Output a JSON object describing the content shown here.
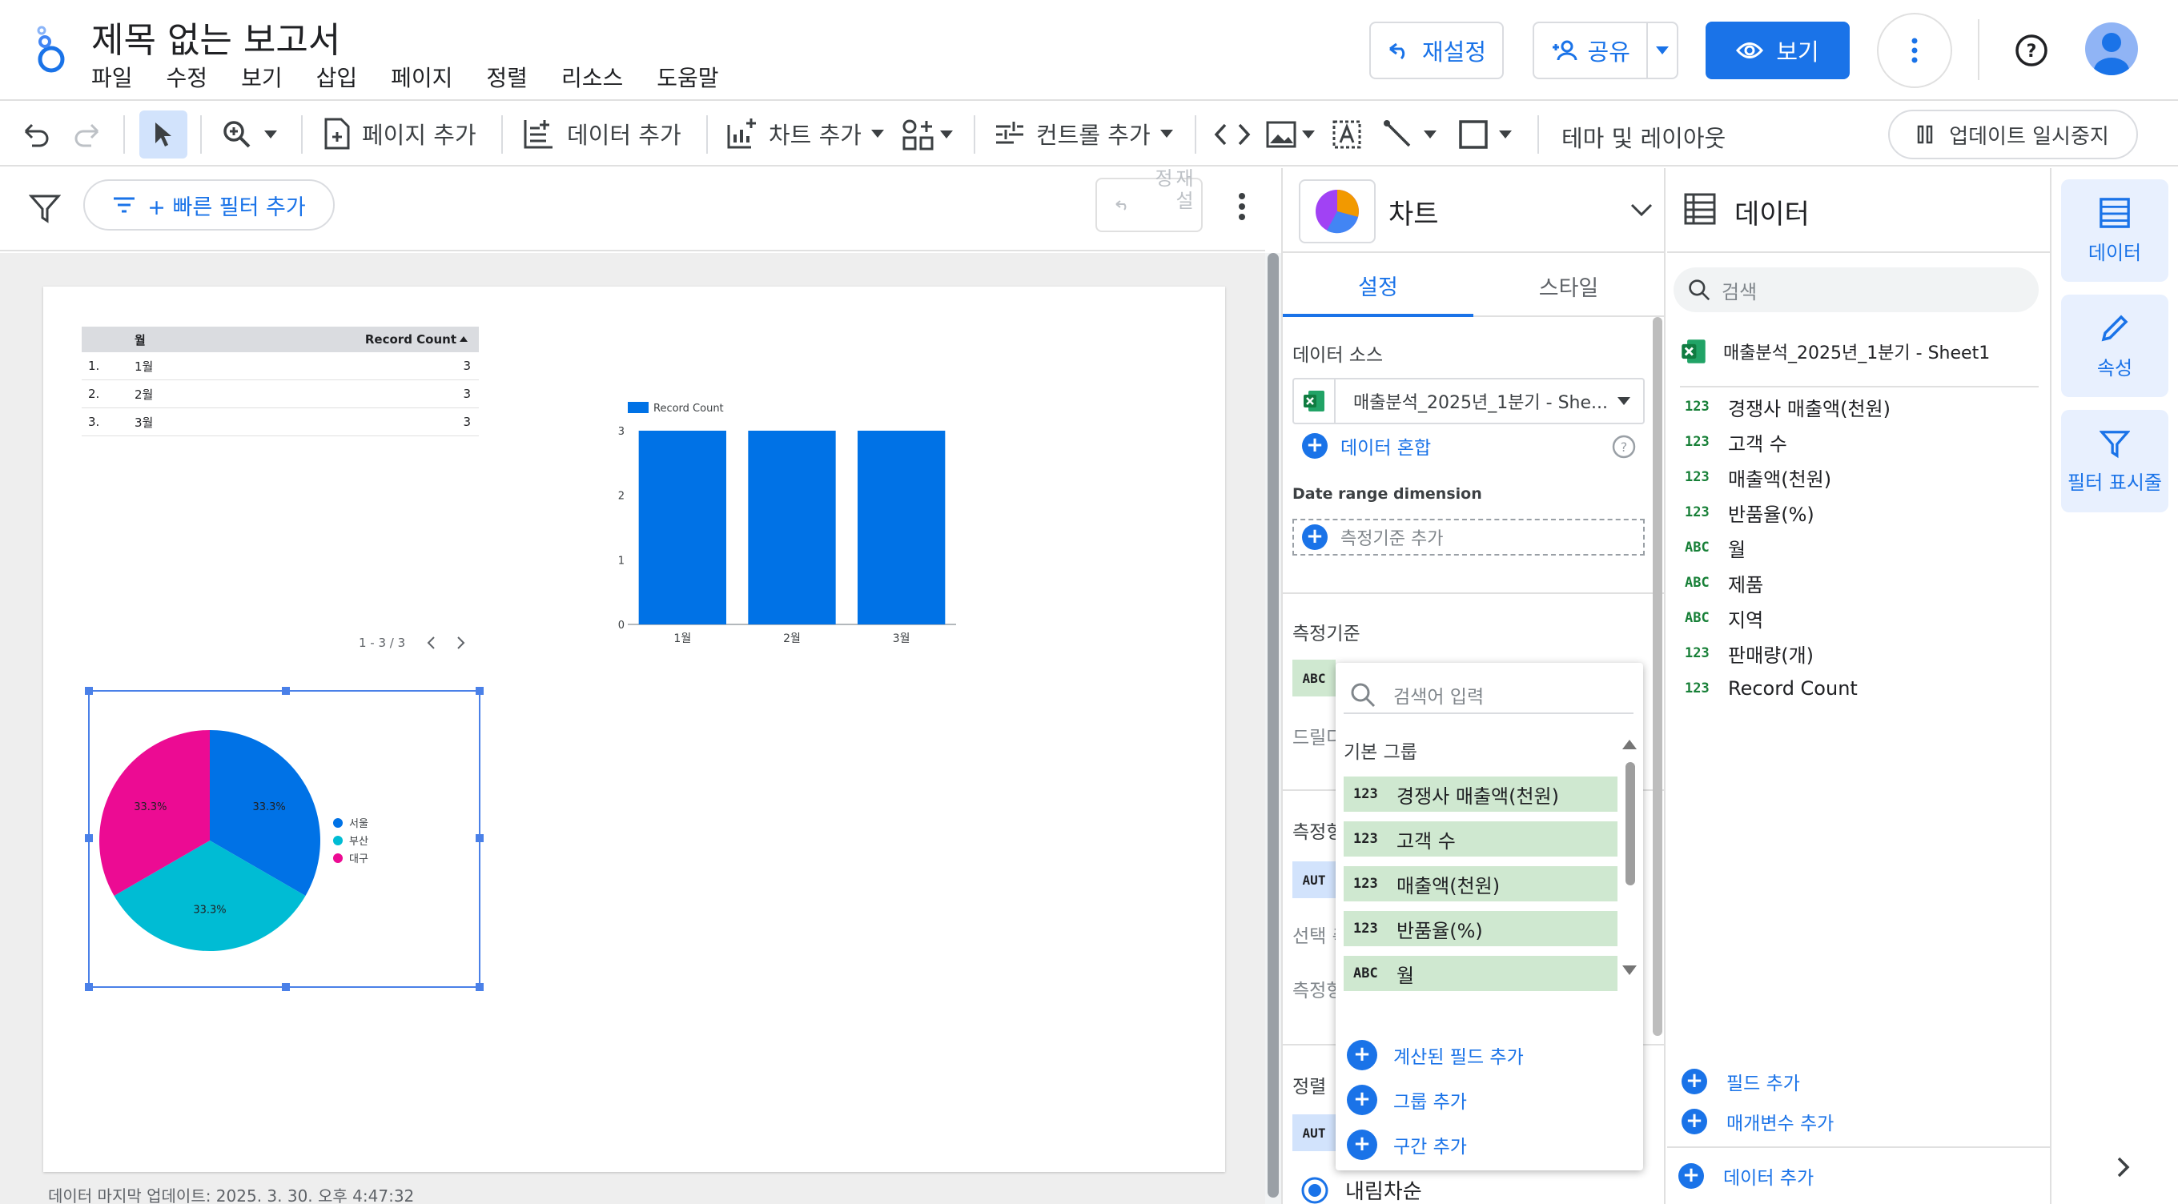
{
  "app": {
    "title": "제목 없는 보고서",
    "menu": [
      "파일",
      "수정",
      "보기",
      "삽입",
      "페이지",
      "정렬",
      "리소스",
      "도움말"
    ],
    "reset_label": "재설정",
    "share_label": "공유",
    "view_label": "보기"
  },
  "toolbar": {
    "add_page": "페이지 추가",
    "add_data": "데이터 추가",
    "add_chart": "차트 추가",
    "add_control": "컨트롤 추가",
    "theme_layout": "테마 및 레이아웃",
    "pause_update": "업데이트 일시중지"
  },
  "filterbar": {
    "quick_filter": "+ 빠른 필터 추가",
    "reset": "재설정"
  },
  "report": {
    "table": {
      "headers": [
        "월",
        "Record Count"
      ],
      "rows": [
        {
          "idx": "1.",
          "month": "1월",
          "count": "3"
        },
        {
          "idx": "2.",
          "month": "2월",
          "count": "3"
        },
        {
          "idx": "3.",
          "month": "3월",
          "count": "3"
        }
      ],
      "pagination": "1 - 3 / 3"
    },
    "footer": "데이터 마지막 업데이트: 2025. 3. 30. 오후 4:47:32"
  },
  "chart_data": [
    {
      "type": "table",
      "columns": [
        "월",
        "Record Count"
      ],
      "rows": [
        [
          "1월",
          3
        ],
        [
          "2월",
          3
        ],
        [
          "3월",
          3
        ]
      ]
    },
    {
      "type": "bar",
      "categories": [
        "1월",
        "2월",
        "3월"
      ],
      "series": [
        {
          "name": "Record Count",
          "values": [
            3,
            3,
            3
          ]
        }
      ],
      "ylim": [
        0,
        3
      ],
      "yticks": [
        "0",
        "1",
        "2",
        "3"
      ],
      "legend": "top-left",
      "color": "#0072e6"
    },
    {
      "type": "pie",
      "labels": [
        "서울",
        "부산",
        "대구"
      ],
      "values": [
        33.3,
        33.3,
        33.3
      ],
      "value_labels": [
        "33.3%",
        "33.3%",
        "33.3%"
      ],
      "colors": [
        "#0072e6",
        "#00bcd4",
        "#ec0b93"
      ],
      "legend": "right"
    }
  ],
  "chart_panel": {
    "title": "차트",
    "tabs": [
      "설정",
      "스타일"
    ],
    "data_source_label": "데이터 소스",
    "data_source_value": "매출분석_2025년_1분기 - She...",
    "blend_label": "데이터 혼합",
    "date_range_label": "Date range dimension",
    "add_dimension": "측정기준 추가",
    "dimension_label": "측정기준",
    "drill_label": "드릴다",
    "metric_label": "측정항",
    "select_label": "선택 측",
    "metric_label2": "측정항",
    "sort_label": "정렬",
    "chip_abc": "ABC",
    "chip_aut": "AUT",
    "chip_aut2": "AUT",
    "desc_label": "내림차순"
  },
  "dropdown": {
    "search_placeholder": "검색어 입력",
    "group_label": "기본 그룹",
    "items": [
      {
        "type": "123",
        "label": "경쟁사 매출액(천원)"
      },
      {
        "type": "123",
        "label": "고객 수"
      },
      {
        "type": "123",
        "label": "매출액(천원)"
      },
      {
        "type": "123",
        "label": "반품율(%)"
      },
      {
        "type": "ABC",
        "label": "월"
      }
    ],
    "actions": [
      "계산된 필드 추가",
      "그룹 추가",
      "구간 추가"
    ]
  },
  "data_panel": {
    "title": "데이터",
    "search_placeholder": "검색",
    "source_name": "매출분석_2025년_1분기 - Sheet1",
    "fields": [
      {
        "type": "123",
        "label": "경쟁사 매출액(천원)"
      },
      {
        "type": "123",
        "label": "고객 수"
      },
      {
        "type": "123",
        "label": "매출액(천원)"
      },
      {
        "type": "123",
        "label": "반품율(%)"
      },
      {
        "type": "ABC",
        "label": "월"
      },
      {
        "type": "ABC",
        "label": "제품"
      },
      {
        "type": "ABC",
        "label": "지역"
      },
      {
        "type": "123",
        "label": "판매량(개)"
      },
      {
        "type": "123",
        "label": "Record Count"
      }
    ],
    "add_field": "필드 추가",
    "add_param": "매개변수 추가",
    "add_data": "데이터 추가"
  },
  "rail": {
    "data": "데이터",
    "properties": "속성",
    "filter": "필터 표시줄"
  },
  "colors": {
    "accent": "#1a73e8",
    "bar": "#0072e6",
    "field_green": "#cfe8d0"
  }
}
